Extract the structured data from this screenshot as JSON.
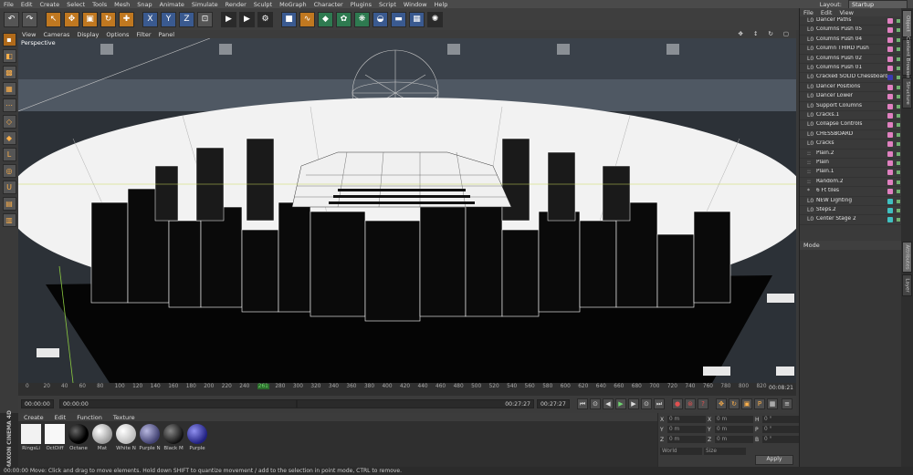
{
  "menubar": {
    "items": [
      "File",
      "Edit",
      "Create",
      "Select",
      "Tools",
      "Mesh",
      "Snap",
      "Animate",
      "Simulate",
      "Render",
      "Sculpt",
      "MoGraph",
      "Character",
      "Plugins",
      "Script",
      "Window",
      "Help"
    ],
    "layout_label": "Layout:",
    "layout_value": "Startup"
  },
  "viewport": {
    "menu": [
      "View",
      "Cameras",
      "Display",
      "Options",
      "Filter",
      "Panel"
    ],
    "label": "Perspective"
  },
  "timeline": {
    "ticks": [
      "0",
      "20",
      "40",
      "60",
      "80",
      "100",
      "120",
      "140",
      "160",
      "180",
      "200",
      "220",
      "240",
      "261",
      "280",
      "300",
      "320",
      "340",
      "360",
      "380",
      "400",
      "420",
      "440",
      "460",
      "480",
      "500",
      "520",
      "540",
      "560",
      "580",
      "600",
      "620",
      "640",
      "660",
      "680",
      "700",
      "720",
      "740",
      "760",
      "780",
      "800",
      "820"
    ],
    "current_frame": "261",
    "end_label": "00:08:21"
  },
  "transport": {
    "start": "00:00:00",
    "min": "00:00:00",
    "max": "00:27:27",
    "end": "00:27:27",
    "current": "00:08:21"
  },
  "material_manager": {
    "menu": [
      "Create",
      "Edit",
      "Function",
      "Texture"
    ],
    "materials": [
      {
        "name": "RingsLi",
        "color": "#f2f2f2"
      },
      {
        "name": "OctDiff",
        "color": "#f8f8f8"
      },
      {
        "name": "Octane",
        "color": "#111111"
      },
      {
        "name": "Mat",
        "color": "#e8e8e8"
      },
      {
        "name": "White N",
        "color": "#dcdcdc"
      },
      {
        "name": "Purple N",
        "color": "#6a6aa0"
      },
      {
        "name": "Black M",
        "color": "#3a3a3a"
      },
      {
        "name": "Purple",
        "color": "#4a4ab0"
      }
    ]
  },
  "brand": "MAXON CINEMA 4D",
  "coordinates": {
    "rows": [
      {
        "axis": "X",
        "pos": "0 m",
        "size": "0 m",
        "rot_label": "H",
        "rot": "0 °"
      },
      {
        "axis": "Y",
        "pos": "0 m",
        "size": "0 m",
        "rot_label": "P",
        "rot": "0 °"
      },
      {
        "axis": "Z",
        "pos": "0 m",
        "size": "0 m",
        "rot_label": "B",
        "rot": "0 °"
      }
    ],
    "mode1": "World",
    "mode2": "Size",
    "apply_label": "Apply"
  },
  "object_manager": {
    "menu": [
      "File",
      "Edit",
      "View",
      "Objects",
      "Tags"
    ],
    "objects": [
      {
        "name": "Dancer Paths",
        "icon": "L0",
        "tag": "#e080c0"
      },
      {
        "name": "Columns Push 05",
        "icon": "L0",
        "tag": "#e080c0"
      },
      {
        "name": "Columns Push 04",
        "icon": "L0",
        "tag": "#e080c0"
      },
      {
        "name": "Column THIRD Push",
        "icon": "L0",
        "tag": "#e080c0"
      },
      {
        "name": "Columns Push 02",
        "icon": "L0",
        "tag": "#e080c0"
      },
      {
        "name": "Columns Push 01",
        "icon": "L0",
        "tag": "#e080c0"
      },
      {
        "name": "Cracked SOLID Chessboard",
        "icon": "L0",
        "tag": "#3a3ab0"
      },
      {
        "name": "Dancer Positions",
        "icon": "L0",
        "tag": "#e080c0"
      },
      {
        "name": "Dancer Lower",
        "icon": "L0",
        "tag": "#e080c0"
      },
      {
        "name": "Support Columns",
        "icon": "L0",
        "tag": "#e080c0"
      },
      {
        "name": "Cracks.1",
        "icon": "L0",
        "tag": "#e080c0"
      },
      {
        "name": "Collapse Controls",
        "icon": "L0",
        "tag": "#e080c0"
      },
      {
        "name": "CHESSBOARD",
        "icon": "L0",
        "tag": "#e080c0"
      },
      {
        "name": "Cracks",
        "icon": "L0",
        "tag": "#e080c0"
      },
      {
        "name": "Plain.2",
        "icon": "::",
        "tag": "#e080c0"
      },
      {
        "name": "Plain",
        "icon": "::",
        "tag": "#e080c0"
      },
      {
        "name": "Plain.1",
        "icon": "::",
        "tag": "#e080c0"
      },
      {
        "name": "Random.2",
        "icon": "::",
        "tag": "#e080c0"
      },
      {
        "name": "6 Ft tiles",
        "icon": "*",
        "tag": "#e080c0"
      },
      {
        "name": "NEW Lighting",
        "icon": "L0",
        "tag": "#40c0c0"
      },
      {
        "name": "Steps.2",
        "icon": "L0",
        "tag": "#40c0c0"
      },
      {
        "name": "Center Stage 2",
        "icon": "L0",
        "tag": "#40c0c0"
      }
    ]
  },
  "attribute_manager": {
    "mode_label": "Mode"
  },
  "side_tabs": [
    "Object",
    "Content Browser",
    "Structure",
    "Attributes",
    "Layer"
  ],
  "status": "00:00:00    Move: Click and drag to move elements. Hold down SHIFT to quantize movement / add to the selection in point mode, CTRL to remove."
}
